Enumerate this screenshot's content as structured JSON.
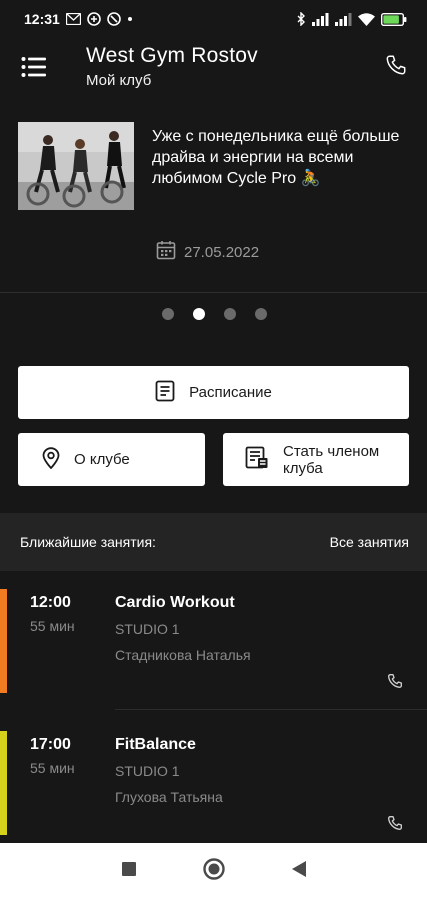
{
  "status": {
    "time": "12:31",
    "battery_level": 0.85
  },
  "header": {
    "title": "West Gym Rostov",
    "subtitle": "Мой клуб"
  },
  "news": {
    "text": "Уже с понедельника ещё больше драйва и энергии на всеми любимом Cycle Pro 🚴",
    "date": "27.05.2022",
    "slide_count": 4,
    "active_slide": 2
  },
  "buttons": {
    "schedule": "Расписание",
    "about": "О клубе",
    "member": "Стать членом клуба"
  },
  "section": {
    "title": "Ближайшие занятия:",
    "all_link": "Все занятия"
  },
  "classes": [
    {
      "time": "12:00",
      "duration": "55 мин",
      "name": "Cardio Workout",
      "studio": "STUDIO 1",
      "trainer": "Стадникова Наталья",
      "color": "#f07b21"
    },
    {
      "time": "17:00",
      "duration": "55 мин",
      "name": "FitBalance",
      "studio": "STUDIO 1",
      "trainer": "Глухова Татьяна",
      "color": "#d4d21b"
    }
  ],
  "colors": {
    "background": "#171717",
    "section_bg": "#242424",
    "accent_orange": "#f07b21",
    "accent_yellow": "#d4d21b"
  }
}
